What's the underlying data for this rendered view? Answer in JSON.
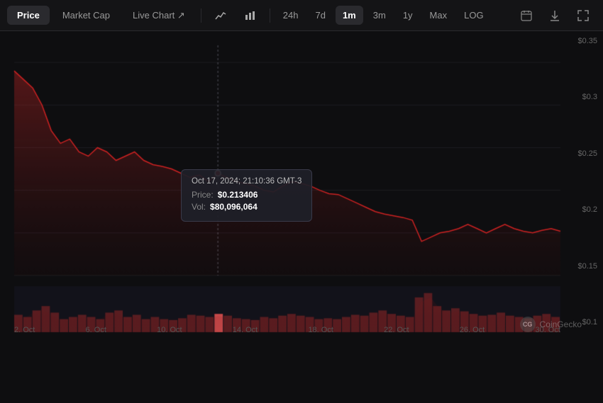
{
  "tabs": [
    {
      "id": "price",
      "label": "Price",
      "active": true
    },
    {
      "id": "marketcap",
      "label": "Market Cap",
      "active": false
    },
    {
      "id": "livechart",
      "label": "Live Chart ↗",
      "active": false
    }
  ],
  "chartIcons": [
    {
      "id": "line-chart",
      "symbol": "↗"
    },
    {
      "id": "bar-chart",
      "symbol": "▦"
    }
  ],
  "timeframes": [
    {
      "id": "24h",
      "label": "24h",
      "active": false
    },
    {
      "id": "7d",
      "label": "7d",
      "active": false
    },
    {
      "id": "1m",
      "label": "1m",
      "active": true
    },
    {
      "id": "3m",
      "label": "3m",
      "active": false
    },
    {
      "id": "1y",
      "label": "1y",
      "active": false
    },
    {
      "id": "max",
      "label": "Max",
      "active": false
    },
    {
      "id": "log",
      "label": "LOG",
      "active": false
    }
  ],
  "rightIcons": [
    {
      "id": "calendar",
      "symbol": "📅"
    },
    {
      "id": "download",
      "symbol": "⬇"
    },
    {
      "id": "expand",
      "symbol": "⛶"
    }
  ],
  "tooltip": {
    "date": "Oct 17, 2024; 21:10:36 GMT-3",
    "price_label": "Price:",
    "price_value": "$0.213406",
    "vol_label": "Vol:",
    "vol_value": "$80,096,064"
  },
  "yAxis": {
    "labels": [
      "$0.35",
      "$0.3",
      "$0.25",
      "$0.2",
      "$0.15",
      "$0.1"
    ]
  },
  "xAxis": {
    "labels": [
      "2. Oct",
      "6. Oct",
      "10. Oct",
      "14. Oct",
      "18. Oct",
      "22. Oct",
      "26. Oct",
      "30. Oct"
    ]
  },
  "coingecko": "CoinGecko",
  "chart": {
    "priceData": [
      0.34,
      0.33,
      0.32,
      0.3,
      0.27,
      0.255,
      0.26,
      0.245,
      0.24,
      0.25,
      0.245,
      0.235,
      0.24,
      0.245,
      0.235,
      0.23,
      0.228,
      0.225,
      0.22,
      0.215,
      0.218,
      0.21,
      0.22,
      0.215,
      0.21,
      0.208,
      0.205,
      0.2,
      0.198,
      0.205,
      0.21,
      0.208,
      0.205,
      0.2,
      0.196,
      0.195,
      0.19,
      0.185,
      0.18,
      0.175,
      0.172,
      0.17,
      0.168,
      0.165,
      0.14,
      0.145,
      0.15,
      0.152,
      0.155,
      0.16,
      0.155,
      0.15,
      0.155,
      0.16,
      0.155,
      0.152,
      0.15,
      0.153,
      0.155,
      0.152
    ],
    "volumeData": [
      0.4,
      0.35,
      0.5,
      0.6,
      0.45,
      0.3,
      0.35,
      0.4,
      0.35,
      0.3,
      0.45,
      0.5,
      0.35,
      0.4,
      0.3,
      0.35,
      0.3,
      0.28,
      0.32,
      0.4,
      0.38,
      0.35,
      0.42,
      0.38,
      0.32,
      0.3,
      0.28,
      0.35,
      0.32,
      0.38,
      0.42,
      0.38,
      0.35,
      0.3,
      0.32,
      0.3,
      0.35,
      0.4,
      0.38,
      0.45,
      0.5,
      0.42,
      0.38,
      0.35,
      0.8,
      0.9,
      0.6,
      0.5,
      0.55,
      0.48,
      0.42,
      0.38,
      0.4,
      0.45,
      0.38,
      0.35,
      0.32,
      0.38,
      0.42,
      0.35
    ]
  }
}
